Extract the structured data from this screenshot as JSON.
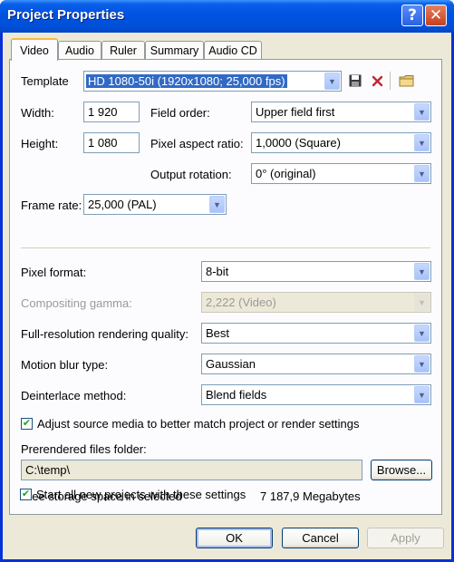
{
  "window": {
    "title": "Project Properties",
    "help_glyph": "?",
    "close_glyph": "✕"
  },
  "tabs": [
    {
      "label": "Video"
    },
    {
      "label": "Audio"
    },
    {
      "label": "Ruler"
    },
    {
      "label": "Summary"
    },
    {
      "label": "Audio CD"
    }
  ],
  "video": {
    "template_label": "Template",
    "template_value": "HD 1080-50i (1920x1080; 25,000 fps)",
    "width_label": "Width:",
    "width_value": "1 920",
    "height_label": "Height:",
    "height_value": "1 080",
    "field_order_label": "Field order:",
    "field_order_value": "Upper field first",
    "pixel_aspect_label": "Pixel aspect ratio:",
    "pixel_aspect_value": "1,0000 (Square)",
    "output_rotation_label": "Output rotation:",
    "output_rotation_value": "0° (original)",
    "frame_rate_label": "Frame rate:",
    "frame_rate_value": "25,000 (PAL)",
    "pixel_format_label": "Pixel format:",
    "pixel_format_value": "8-bit",
    "compositing_gamma_label": "Compositing gamma:",
    "compositing_gamma_value": "2,222 (Video)",
    "render_quality_label": "Full-resolution rendering quality:",
    "render_quality_value": "Best",
    "motion_blur_label": "Motion blur type:",
    "motion_blur_value": "Gaussian",
    "deinterlace_label": "Deinterlace method:",
    "deinterlace_value": "Blend fields",
    "adjust_source_label": "Adjust source media to better match project or render settings",
    "adjust_source_checked": true,
    "prerendered_label": "Prerendered files folder:",
    "prerendered_value": "C:\\temp\\",
    "browse_label": "Browse...",
    "free_space_label": "Free storage space in selected",
    "free_space_value": "7 187,9 Megabytes",
    "start_new_label": "Start all new projects with these settings",
    "start_new_checked": true
  },
  "buttons": {
    "ok": "OK",
    "cancel": "Cancel",
    "apply": "Apply"
  },
  "icons": {
    "save": "save-icon",
    "delete": "delete-icon",
    "folder": "folder-icon",
    "check": "✔",
    "arrow": "▼"
  },
  "colors": {
    "title_bar": "#0054e3",
    "selection": "#316ac5",
    "dialog_bg": "#ece9d8",
    "delete_red": "#c0272d"
  }
}
